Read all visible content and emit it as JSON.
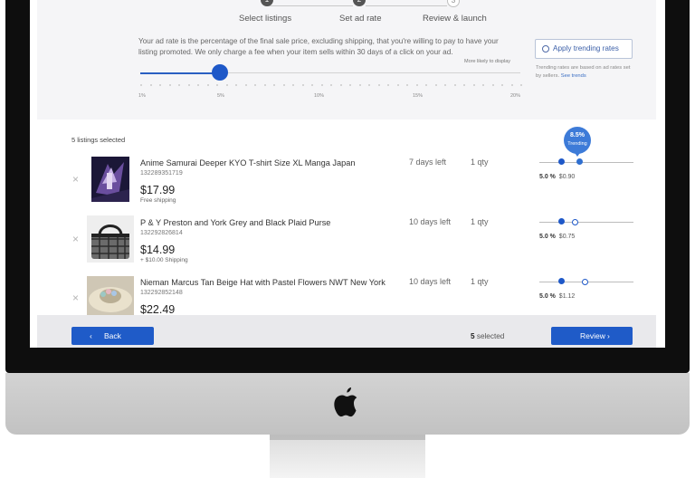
{
  "stepper": {
    "steps": [
      {
        "number": "1",
        "label": "Select listings",
        "state": "done"
      },
      {
        "number": "2",
        "label": "Set ad rate",
        "state": "done"
      },
      {
        "number": "3",
        "label": "Review & launch",
        "state": "todo"
      }
    ]
  },
  "ad_rate": {
    "description": "Your ad rate is the percentage of the final sale price, excluding shipping, that you're willing to pay to have your listing promoted. We only charge a fee when your item sells within 30 days of a click on your ad.",
    "more_likely_label": "More likely to display",
    "slider": {
      "min": 1,
      "max": 20,
      "value": 5,
      "tick_labels": [
        "1%",
        "5%",
        "10%",
        "15%",
        "20%"
      ]
    },
    "trending_button_label": "Apply trending rates",
    "trending_note": "Trending rates are based on ad rates set by sellers.",
    "trending_link": "See trends"
  },
  "listings": {
    "selected_label": "5 listings selected",
    "trending_bubble": {
      "percent": "8.5%",
      "label": "Trending"
    },
    "items": [
      {
        "title": "Anime Samurai Deeper KYO T-shirt Size XL Manga Japan",
        "item_id": "132289351719",
        "price": "$17.99",
        "shipping": "Free shipping",
        "time_left": "7 days left",
        "qty": "1 qty",
        "rate": "5.0 %",
        "fee": "$0.90",
        "trending_rate": 8.5
      },
      {
        "title": "P & Y Preston and York Grey and Black Plaid Purse",
        "item_id": "132292826814",
        "price": "$14.99",
        "shipping": "+ $10.00 Shipping",
        "time_left": "10 days left",
        "qty": "1 qty",
        "rate": "5.0 %",
        "fee": "$0.75",
        "trending_rate": 8.5
      },
      {
        "title": "Nieman Marcus Tan Beige Hat with Pastel Flowers NWT New York",
        "item_id": "132292852148",
        "price": "$22.49",
        "shipping": "",
        "time_left": "10 days left",
        "qty": "1 qty",
        "rate": "5.0 %",
        "fee": "$1.12",
        "trending_rate": 8.5
      }
    ]
  },
  "footer": {
    "back_label": "Back",
    "selected_count": "5",
    "selected_word": "selected",
    "review_label": "Review"
  },
  "colors": {
    "accent": "#1f5bc8",
    "trending": "#3d7bd8",
    "panel": "#f5f5f7",
    "bezel": "#0e0e0e"
  },
  "icons": [
    "close-icon",
    "chevron-left-icon",
    "chevron-right-icon",
    "circle-icon",
    "apple-logo-icon"
  ]
}
